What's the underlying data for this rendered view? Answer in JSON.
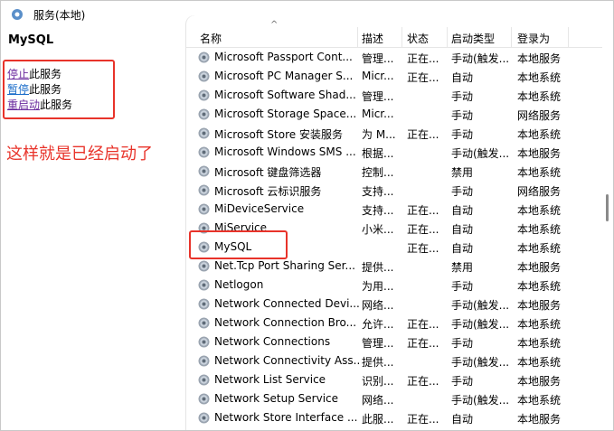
{
  "window": {
    "title": "服务(本地)"
  },
  "left": {
    "service_name": "MySQL",
    "actions": [
      {
        "link": "停止",
        "suffix": "此服务"
      },
      {
        "link": "暂停",
        "suffix": "此服务"
      },
      {
        "link": "重启动",
        "suffix": "此服务"
      }
    ],
    "note": "这样就是已经启动了"
  },
  "table": {
    "headers": {
      "name": "名称",
      "desc": "描述",
      "status": "状态",
      "startup": "启动类型",
      "logon": "登录为"
    },
    "sort_indicator": "^",
    "rows": [
      {
        "name": "Microsoft Passport Cont...",
        "desc": "管理...",
        "status": "正在...",
        "startup": "手动(触发...",
        "logon": "本地服务"
      },
      {
        "name": "Microsoft PC Manager S...",
        "desc": "Micr...",
        "status": "正在...",
        "startup": "自动",
        "logon": "本地系统"
      },
      {
        "name": "Microsoft Software Shad...",
        "desc": "管理...",
        "status": "",
        "startup": "手动",
        "logon": "本地系统"
      },
      {
        "name": "Microsoft Storage Space...",
        "desc": "Micr...",
        "status": "",
        "startup": "手动",
        "logon": "网络服务"
      },
      {
        "name": "Microsoft Store 安装服务",
        "desc": "为 M...",
        "status": "正在...",
        "startup": "手动",
        "logon": "本地系统"
      },
      {
        "name": "Microsoft Windows SMS ...",
        "desc": "根据...",
        "status": "",
        "startup": "手动(触发...",
        "logon": "本地服务"
      },
      {
        "name": "Microsoft 键盘筛选器",
        "desc": "控制...",
        "status": "",
        "startup": "禁用",
        "logon": "本地系统"
      },
      {
        "name": "Microsoft 云标识服务",
        "desc": "支持...",
        "status": "",
        "startup": "手动",
        "logon": "网络服务"
      },
      {
        "name": "MiDeviceService",
        "desc": "支持...",
        "status": "正在...",
        "startup": "自动",
        "logon": "本地系统"
      },
      {
        "name": "MiService",
        "desc": "小米...",
        "status": "正在...",
        "startup": "自动",
        "logon": "本地系统"
      },
      {
        "name": "MySQL",
        "desc": "",
        "status": "正在...",
        "startup": "自动",
        "logon": "本地系统"
      },
      {
        "name": "Net.Tcp Port Sharing Ser...",
        "desc": "提供...",
        "status": "",
        "startup": "禁用",
        "logon": "本地服务"
      },
      {
        "name": "Netlogon",
        "desc": "为用...",
        "status": "",
        "startup": "手动",
        "logon": "本地系统"
      },
      {
        "name": "Network Connected Devi...",
        "desc": "网络...",
        "status": "",
        "startup": "手动(触发...",
        "logon": "本地服务"
      },
      {
        "name": "Network Connection Bro...",
        "desc": "允许...",
        "status": "正在...",
        "startup": "手动(触发...",
        "logon": "本地系统"
      },
      {
        "name": "Network Connections",
        "desc": "管理...",
        "status": "正在...",
        "startup": "手动",
        "logon": "本地系统"
      },
      {
        "name": "Network Connectivity Ass...",
        "desc": "提供...",
        "status": "",
        "startup": "手动(触发...",
        "logon": "本地系统"
      },
      {
        "name": "Network List Service",
        "desc": "识别...",
        "status": "正在...",
        "startup": "手动",
        "logon": "本地服务"
      },
      {
        "name": "Network Setup Service",
        "desc": "网络...",
        "status": "",
        "startup": "手动(触发...",
        "logon": "本地系统"
      },
      {
        "name": "Network Store Interface ...",
        "desc": "此服...",
        "status": "正在...",
        "startup": "自动",
        "logon": "本地服务"
      }
    ]
  }
}
